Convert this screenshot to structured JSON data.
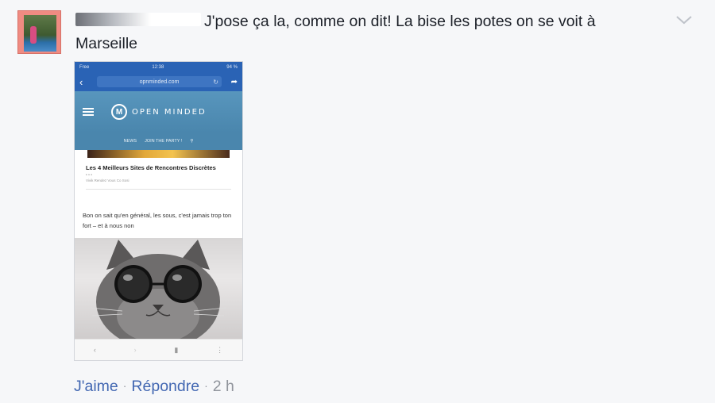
{
  "comment": {
    "text": "J'pose ça la, comme on dit! La bise les potes on se voit à Marseille",
    "actions": {
      "like": "J'aime",
      "reply": "Répondre",
      "time": "2 h",
      "separator": "·"
    }
  },
  "attachment": {
    "status_bar": {
      "carrier": "Free",
      "time": "12:38",
      "battery": "94 %"
    },
    "url": "opnminded.com",
    "site_logo": "OPEN MINDED",
    "nav": [
      "NEWS",
      "JOIN THE PARTY !"
    ],
    "article_title": "Les 4 Meilleurs Sites de Rencontres Discrètes",
    "article_meta": "Vivik Rendez Vous Co Sosi",
    "article_body": "Bon on sait qu'en général, les sous, c'est jamais trop ton fort – et à nous non"
  },
  "colors": {
    "link": "#4267b2",
    "text": "#1d2129",
    "muted": "#90949c",
    "background": "#f6f7f9"
  }
}
